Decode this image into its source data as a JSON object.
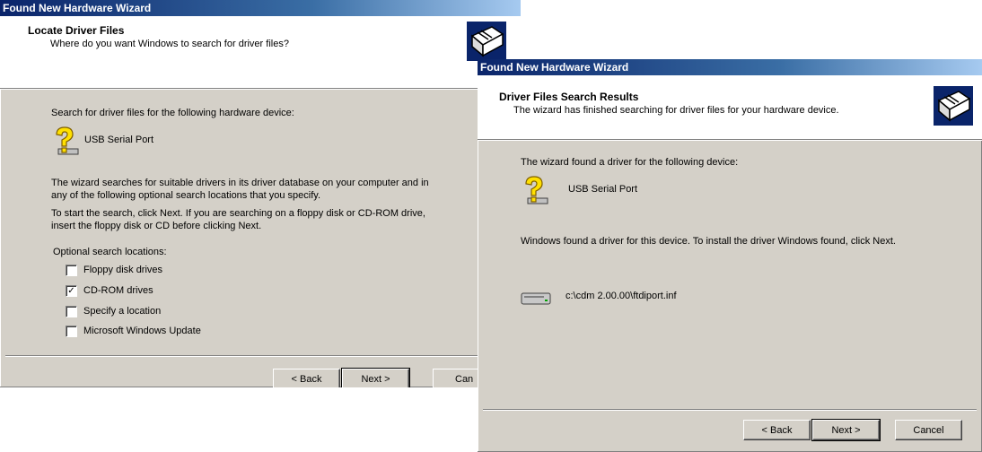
{
  "locate_wizard": {
    "title": "Found New Hardware Wizard",
    "header_title": "Locate Driver Files",
    "header_subtitle": "Where do you want Windows to search for driver files?",
    "search_intro": "Search for driver files for the following hardware device:",
    "device_name": "USB Serial Port",
    "info_line1": "The wizard searches for suitable drivers in its driver database on your computer and in",
    "info_line2": "any of the following optional search locations that you specify.",
    "info_line3": "To start the search, click Next. If you are searching on a floppy disk or CD-ROM drive,",
    "info_line4": "insert the floppy disk or CD before clicking Next.",
    "optional_label": "Optional search locations:",
    "options": [
      {
        "label": "Floppy disk drives",
        "checked": false
      },
      {
        "label": "CD-ROM drives",
        "checked": true
      },
      {
        "label": "Specify a location",
        "checked": false
      },
      {
        "label": "Microsoft Windows Update",
        "checked": false
      }
    ],
    "back_label": "< Back",
    "next_label": "Next >",
    "cancel_label": "Can"
  },
  "results_wizard": {
    "title": "Found New Hardware Wizard",
    "header_title": "Driver Files Search Results",
    "header_subtitle": "The wizard has finished searching for driver files for your hardware device.",
    "found_text": "The wizard found a driver for the following device:",
    "device_name": "USB Serial Port",
    "install_text": "Windows found a driver for this device. To install the driver Windows found, click Next.",
    "driver_path": "c:\\cdm 2.00.00\\ftdiport.inf",
    "back_label": "< Back",
    "next_label": "Next >",
    "cancel_label": "Cancel"
  },
  "colors": {
    "titlebar": "#0a246a",
    "dialog_face": "#d4d0c8",
    "header_bg": "#ffffff"
  },
  "icons": [
    "hardware-wizard-icon",
    "question-hardware-icon",
    "drive-icon"
  ]
}
